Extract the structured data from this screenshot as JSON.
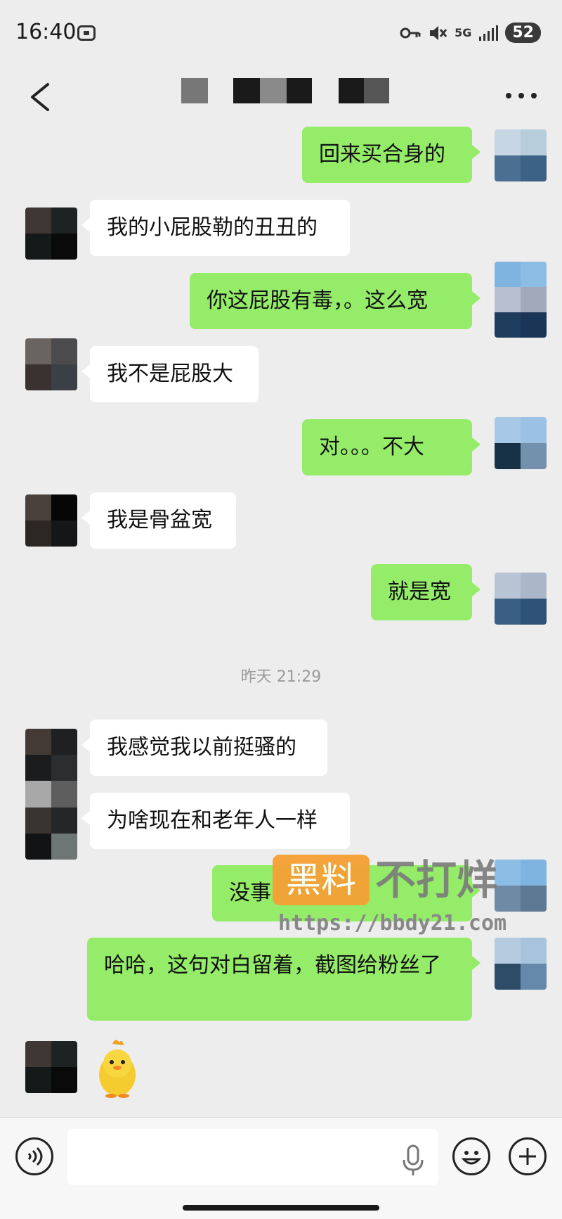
{
  "status": {
    "time": "16:40",
    "network": "5G",
    "battery": "52"
  },
  "chat": {
    "messages": [
      {
        "dir": "out",
        "text": "回来买合身的"
      },
      {
        "dir": "in",
        "text": "我的小屁股勒的丑丑的"
      },
      {
        "dir": "out",
        "text": "你这屁股有毒，。这么宽"
      },
      {
        "dir": "in",
        "text": "我不是屁股大"
      },
      {
        "dir": "out",
        "text": "对。。。不大"
      },
      {
        "dir": "in",
        "text": "我是骨盆宽"
      },
      {
        "dir": "out",
        "text": "就是宽"
      },
      {
        "dir": "in",
        "text": "我感觉我以前挺骚的"
      },
      {
        "dir": "in",
        "text": "为啥现在和老年人一样"
      },
      {
        "dir": "out",
        "text": "没事"
      },
      {
        "dir": "out",
        "text": "哈哈，这句对白留着，截图给粉丝了"
      }
    ],
    "timestamp": "昨天 21:29",
    "sticker": "duck-sticker"
  },
  "watermark": {
    "badge": "黑料",
    "text": "不打烊",
    "url": "https://bbdy21.com"
  },
  "colors": {
    "background": "#ededed",
    "incoming": "#ffffff",
    "outgoing": "#95ec69",
    "watermark_orange": "#f5a034"
  },
  "icons": [
    "back-icon",
    "more-icon",
    "voice-icon",
    "mic-icon",
    "emoji-icon",
    "plus-icon"
  ]
}
